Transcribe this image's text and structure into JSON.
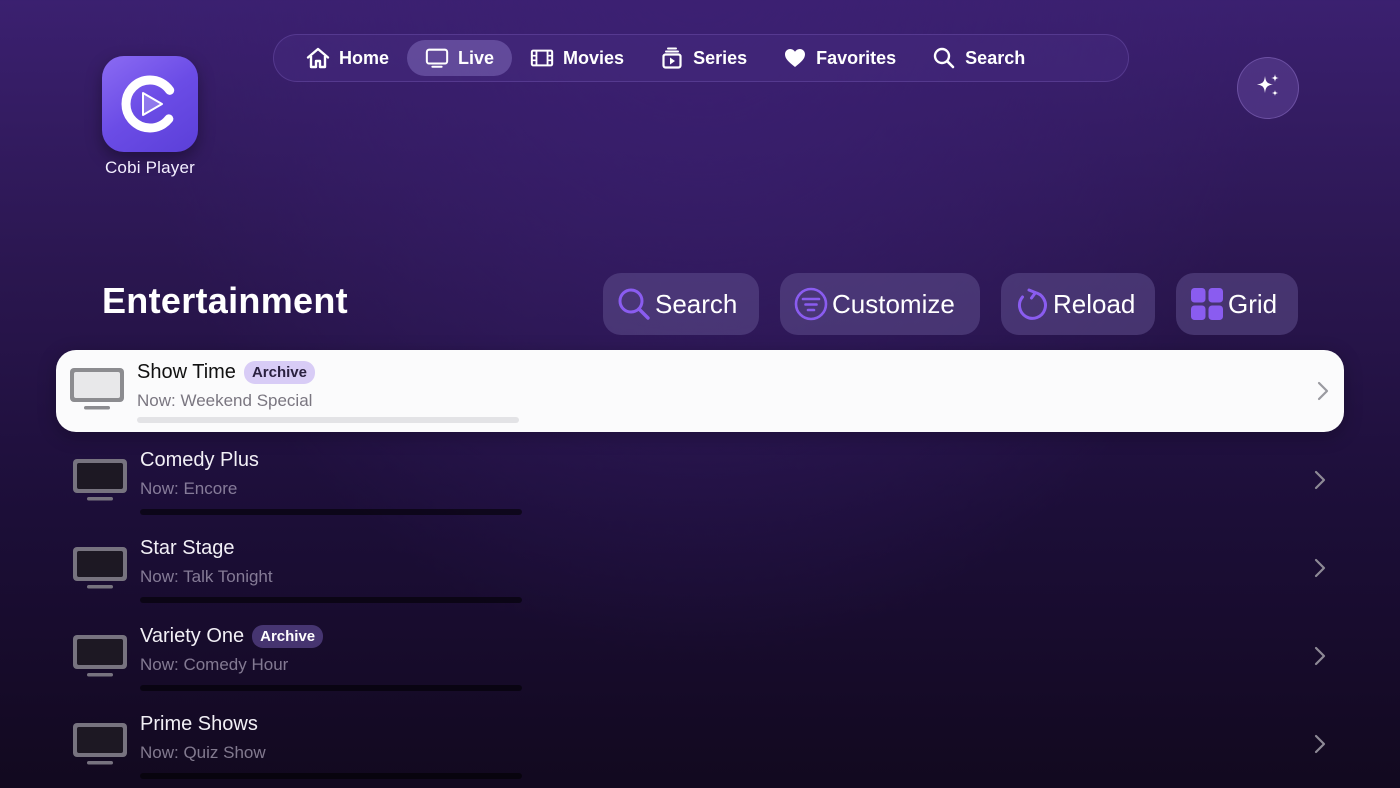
{
  "app": {
    "name": "Cobi Player",
    "icon": "play-c-logo-icon",
    "accent": "#6b4ce6"
  },
  "nav": {
    "items": [
      {
        "label": "Home",
        "icon": "home-icon",
        "active": false
      },
      {
        "label": "Live",
        "icon": "tv-icon",
        "active": true
      },
      {
        "label": "Movies",
        "icon": "film-icon",
        "active": false
      },
      {
        "label": "Series",
        "icon": "series-icon",
        "active": false
      },
      {
        "label": "Favorites",
        "icon": "heart-icon",
        "active": false
      },
      {
        "label": "Search",
        "icon": "search-icon",
        "active": false
      }
    ]
  },
  "sparkle_button": {
    "icon": "sparkle-icon"
  },
  "section": {
    "title": "Entertainment",
    "actions": [
      {
        "label": "Search",
        "icon": "search-icon"
      },
      {
        "label": "Customize",
        "icon": "filter-icon"
      },
      {
        "label": "Reload",
        "icon": "reload-icon"
      },
      {
        "label": "Grid",
        "icon": "grid-icon"
      }
    ]
  },
  "channels": [
    {
      "name": "Show Time",
      "badge": "Archive",
      "now": "Now: Weekend Special",
      "progress": 0.0,
      "selected": true
    },
    {
      "name": "Comedy Plus",
      "badge": "",
      "now": "Now: Encore",
      "progress": 0.0,
      "selected": false
    },
    {
      "name": "Star Stage",
      "badge": "",
      "now": "Now: Talk Tonight",
      "progress": 0.0,
      "selected": false
    },
    {
      "name": "Variety One",
      "badge": "Archive",
      "now": "Now: Comedy Hour",
      "progress": 0.0,
      "selected": false
    },
    {
      "name": "Prime Shows",
      "badge": "",
      "now": "Now: Quiz Show",
      "progress": 0.0,
      "selected": false
    }
  ],
  "colors": {
    "icon_purple": "#8a5cf0",
    "selected_row": "#fbfbfc",
    "badge_selected": "#d8ccf6"
  }
}
